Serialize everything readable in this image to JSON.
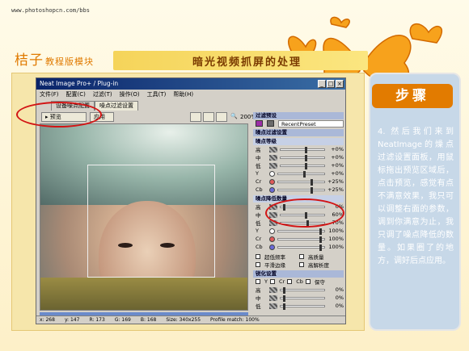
{
  "site_url": "www.photoshopcn.com/bbs",
  "brand": {
    "main": "桔子",
    "sub": "教程版模块"
  },
  "page_title": "暗光视频抓屏的处理",
  "steps_label": "步骤",
  "step_text": "4. 然后我们来到NeatImage的燥点过滤设置面板，用鼠标拖出预览区域后，点击预览，感觉有点不满意效果，我只可以调整右面的参数，调到你满意为止，我只调了噪点降低的数量。如果圈了的地方，调好后点应用。",
  "window": {
    "title": "Neat Image Pro+ / Plug-in",
    "menu": [
      "文件(F)",
      "配置(C)",
      "过滤(T)",
      "操作(O)",
      "工具(T)",
      "帮助(H)"
    ],
    "tabs": [
      "设备噪点配置",
      "噪点过滤设置"
    ],
    "preview_button": "▸ 预览",
    "apply_button": "应用",
    "zoom": "200%",
    "status": {
      "x": "x: 268",
      "y": "y: 147",
      "r": "R: 173",
      "g": "G: 169",
      "b": "B: 168",
      "size": "Size: 340x255",
      "match": "Profile match: 100%"
    }
  },
  "settings": {
    "preset_title": "过滤预设",
    "preset_value": "RecentPreset",
    "filter_title": "噪点过滤设置",
    "level_title": "噪点等级",
    "levels": [
      {
        "label": "高",
        "value": "+0%",
        "pos": 0.55
      },
      {
        "label": "中",
        "value": "+0%",
        "pos": 0.55
      },
      {
        "label": "低",
        "value": "+0%",
        "pos": 0.55
      },
      {
        "label": "Y",
        "value": "+0%",
        "pos": 0.55
      },
      {
        "label": "Cr",
        "value": "+25%",
        "pos": 0.7
      },
      {
        "label": "Cb",
        "value": "+25%",
        "pos": 0.7
      }
    ],
    "reduce_title": "噪点降低数量",
    "reduce": [
      {
        "label": "高",
        "value": "0%",
        "pos": 0.05
      },
      {
        "label": "中",
        "value": "60%",
        "pos": 0.55
      },
      {
        "label": "低",
        "value": "70%",
        "pos": 0.6
      },
      {
        "label": "Y",
        "value": "100%",
        "pos": 0.9
      },
      {
        "label": "Cr",
        "value": "100%",
        "pos": 0.9
      },
      {
        "label": "Cb",
        "value": "100%",
        "pos": 0.9
      }
    ],
    "options": [
      "超低频率",
      "高质量",
      "平滑边缘",
      "高解析度"
    ],
    "sharpen_title": "锐化设置",
    "sharpen_checks": [
      "Y",
      "Cr",
      "Cb",
      "保守"
    ],
    "sharpen": [
      {
        "label": "高",
        "value": "0%"
      },
      {
        "label": "中",
        "value": "0%"
      },
      {
        "label": "低",
        "value": "0%"
      }
    ]
  },
  "colors": {
    "accent": "#e27b00",
    "highlight_circle": "#d21414",
    "titlebar": "#0a246a"
  }
}
